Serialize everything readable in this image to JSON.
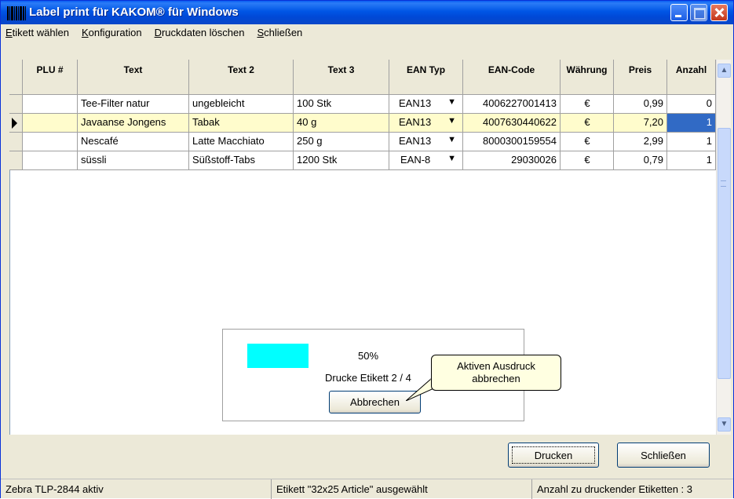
{
  "window": {
    "title": "Label print für KAKOM® für Windows"
  },
  "menu": [
    {
      "underline": "E",
      "rest": "tikett wählen"
    },
    {
      "underline": "K",
      "rest": "onfiguration"
    },
    {
      "underline": "D",
      "rest": "ruckdaten löschen"
    },
    {
      "underline": "S",
      "rest": "chließen"
    }
  ],
  "table": {
    "columns": [
      "PLU #",
      "Text",
      "Text 2",
      "Text 3",
      "EAN Typ",
      "EAN-Code",
      "Währung",
      "Preis",
      "Anzahl"
    ],
    "rows": [
      {
        "plu": "",
        "text": "Tee-Filter natur",
        "text2": "ungebleicht",
        "text3": "100 Stk",
        "ean_typ": "EAN13",
        "ean_code": "4006227001413",
        "currency": "€",
        "price": "0,99",
        "count": "0",
        "selected": false
      },
      {
        "plu": "",
        "text": "Javaanse Jongens",
        "text2": "Tabak",
        "text3": "40 g",
        "ean_typ": "EAN13",
        "ean_code": "4007630440622",
        "currency": "€",
        "price": "7,20",
        "count": "1",
        "selected": true
      },
      {
        "plu": "",
        "text": "Nescafé",
        "text2": "Latte Macchiato",
        "text3": "250 g",
        "ean_typ": "EAN13",
        "ean_code": "8000300159554",
        "currency": "€",
        "price": "2,99",
        "count": "1",
        "selected": false
      },
      {
        "plu": "",
        "text": "süssli",
        "text2": "Süßstoff-Tabs",
        "text3": "1200 Stk",
        "ean_typ": "EAN-8",
        "ean_code": "29030026",
        "currency": "€",
        "price": "0,79",
        "count": "1",
        "selected": false
      }
    ]
  },
  "progress": {
    "percent": 50,
    "percent_label": "50%",
    "status": "Drucke Etikett 2 / 4",
    "abort_label": "Abbrechen",
    "fill_color": "#00ffff"
  },
  "tooltip": {
    "line1": "Aktiven Ausdruck",
    "line2": "abbrechen"
  },
  "buttons": {
    "print": "Drucken",
    "close": "Schließen"
  },
  "statusbar": {
    "printer": "Zebra TLP-2844 aktiv",
    "label": "Etikett \"32x25 Article\" ausgewählt",
    "count": "Anzahl zu druckender Etiketten : 3"
  }
}
